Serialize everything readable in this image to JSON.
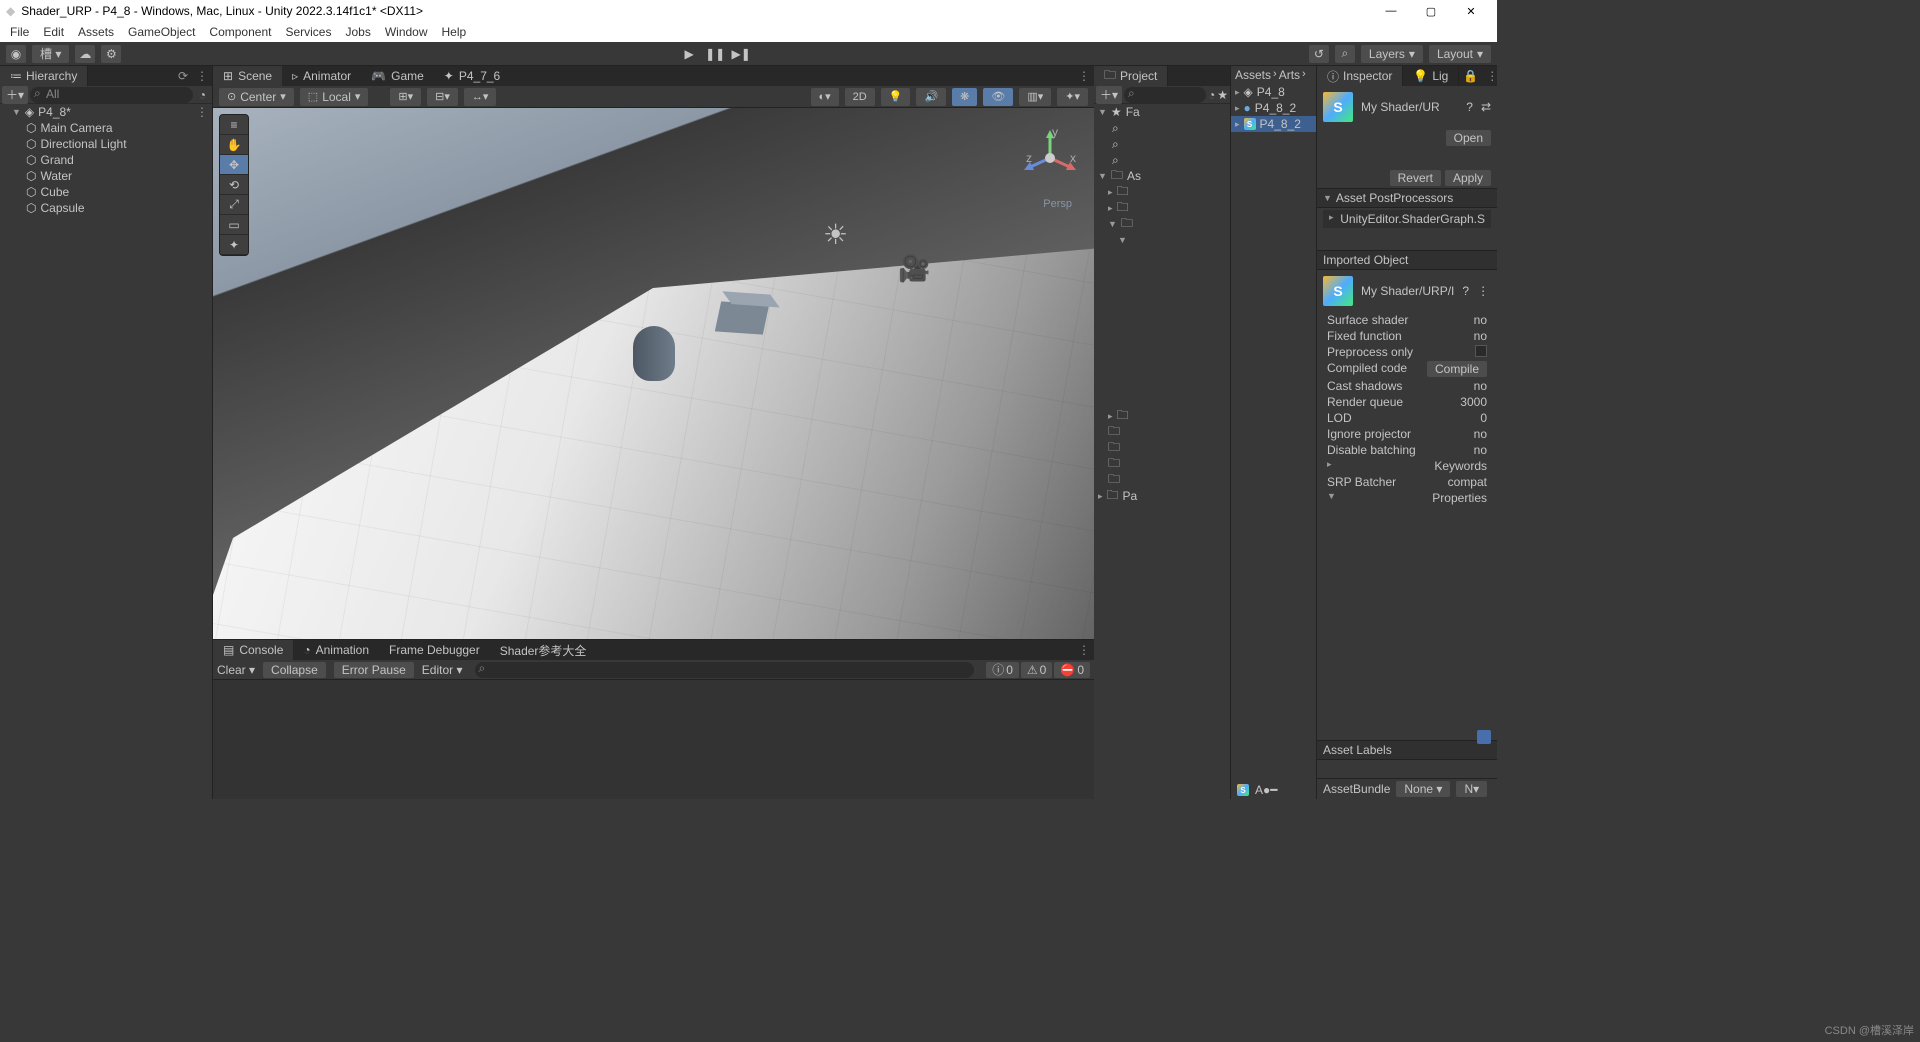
{
  "title": "Shader_URP - P4_8 - Windows, Mac, Linux - Unity 2022.3.14f1c1* <DX11>",
  "menu": {
    "file": "File",
    "edit": "Edit",
    "assets": "Assets",
    "gameobject": "GameObject",
    "component": "Component",
    "services": "Services",
    "jobs": "Jobs",
    "window": "Window",
    "help": "Help"
  },
  "top": {
    "account": "槽 ▾",
    "layers": "Layers",
    "layout": "Layout"
  },
  "hierarchy": {
    "title": "Hierarchy",
    "searchPlaceholder": "All",
    "scene": "P4_8*",
    "items": [
      "Main Camera",
      "Directional Light",
      "Grand",
      "Water",
      "Cube",
      "Capsule"
    ]
  },
  "centerTabs": {
    "scene": "Scene",
    "animator": "Animator",
    "game": "Game",
    "extra": "P4_7_6"
  },
  "sceneToolbar": {
    "pivot": "Center",
    "space": "Local",
    "mode2d": "2D"
  },
  "viewport": {
    "persp": "Persp"
  },
  "console": {
    "tabs": {
      "console": "Console",
      "animation": "Animation",
      "frame": "Frame Debugger",
      "shader": "Shader参考大全"
    },
    "bar": {
      "clear": "Clear",
      "collapse": "Collapse",
      "errorpause": "Error Pause",
      "editor": "Editor"
    },
    "counts": {
      "info": "0",
      "warn": "0",
      "error": "0"
    }
  },
  "project": {
    "title": "Project",
    "fav": "Fa",
    "assets": "As",
    "packages": "Pa",
    "crumbs": [
      "Assets",
      "Arts"
    ],
    "items": [
      {
        "name": "P4_8",
        "type": "scene"
      },
      {
        "name": "P4_8_2",
        "type": "mat"
      },
      {
        "name": "P4_8_2",
        "type": "sg",
        "sel": true
      }
    ]
  },
  "inspector": {
    "title": "Inspector",
    "lig": "Lig",
    "shaderName": "My Shader/UR",
    "open": "Open",
    "revert": "Revert",
    "apply": "Apply",
    "postproc": "Asset PostProcessors",
    "postprocItem": "UnityEditor.ShaderGraph.S",
    "imported": "Imported Object",
    "shaderName2": "My Shader/URP/I",
    "props": [
      {
        "k": "Surface shader",
        "v": "no"
      },
      {
        "k": "Fixed function",
        "v": "no"
      },
      {
        "k": "Preprocess only",
        "v": ""
      },
      {
        "k": "Compiled code",
        "v": "Compile"
      },
      {
        "k": "Cast shadows",
        "v": "no"
      },
      {
        "k": "Render queue",
        "v": "3000"
      },
      {
        "k": "LOD",
        "v": "0"
      },
      {
        "k": "Ignore projector",
        "v": "no"
      },
      {
        "k": "Disable batching",
        "v": "no"
      }
    ],
    "keywords": "Keywords",
    "srp": "SRP Batcher",
    "srpv": "compat",
    "properties": "Properties",
    "assetlabels": "Asset Labels",
    "assetbundle": "AssetBundle",
    "none": "None",
    "n": "N"
  },
  "watermark": "CSDN @槽溪泽岸"
}
